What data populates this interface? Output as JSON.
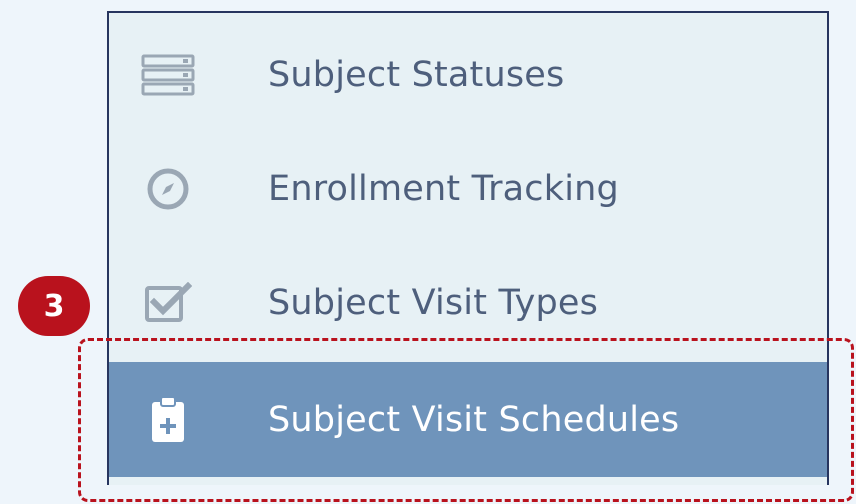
{
  "menu": {
    "items": [
      {
        "label": "Subject Statuses",
        "icon": "list-icon",
        "selected": false
      },
      {
        "label": "Enrollment Tracking",
        "icon": "compass-icon",
        "selected": false
      },
      {
        "label": "Subject Visit Types",
        "icon": "checkbox-icon",
        "selected": false
      },
      {
        "label": "Subject Visit Schedules",
        "icon": "clipboard-plus-icon",
        "selected": true
      }
    ]
  },
  "callout": {
    "number": "3"
  },
  "colors": {
    "selected_bg": "#6f94bb",
    "panel_bg": "#e7f1f5",
    "callout_red": "#b9121d",
    "icon_gray": "#9aa7b4"
  }
}
